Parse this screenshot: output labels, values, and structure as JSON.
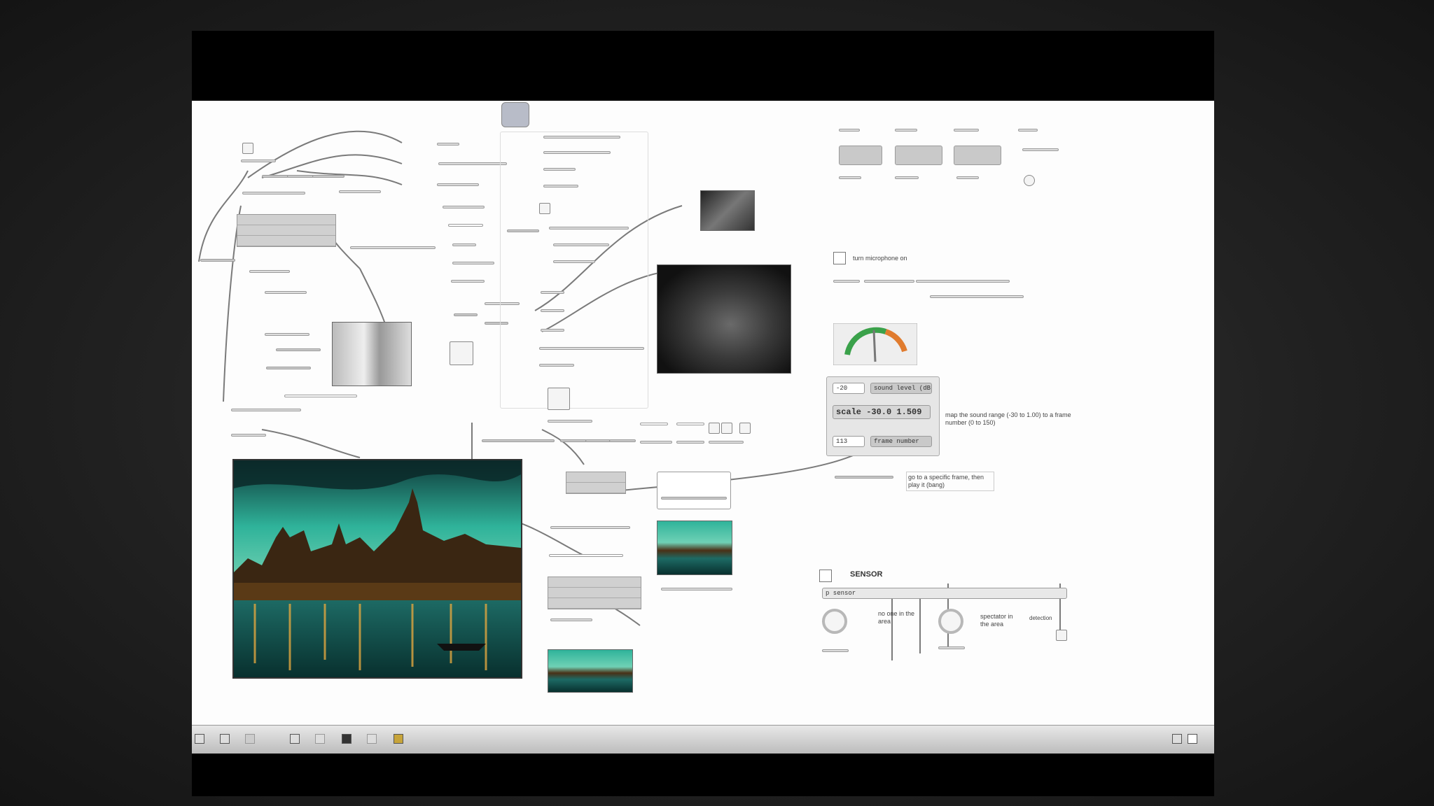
{
  "patcher": {
    "sensor_section": {
      "title": "SENSOR",
      "sensor_object": "p sensor",
      "label_left": "no one in the area",
      "label_right": "spectator in the area",
      "side_note": "detection"
    },
    "scale_box": {
      "number_top": "-20",
      "label_top": "sound level (dB)",
      "scale_object": "scale -30.0 1.509",
      "number_bottom": "113",
      "label_bottom": "frame number"
    },
    "map_comment": "map the sound range (-30 to 1.00) to a frame number (0 to 150)",
    "mic_comment": "turn microphone on",
    "goto_comment": "go to a specific frame, then play it (bang)",
    "colors": {
      "canvas": "#fdfdfd",
      "object_fill": "#dedede",
      "message_fill": "#c9c9c9",
      "wire": "#7a7a7a",
      "meter_green": "#3aa14a",
      "meter_orange": "#e07b2e"
    },
    "toolbar_icons": [
      "lock-icon",
      "edit-icon",
      "new-object-icon",
      "patch-icon",
      "present-icon",
      "grid-icon",
      "inspector-icon",
      "clue-icon"
    ],
    "toolbar_right_icons": [
      "sidebar-icon",
      "toggle-panel-icon"
    ]
  }
}
